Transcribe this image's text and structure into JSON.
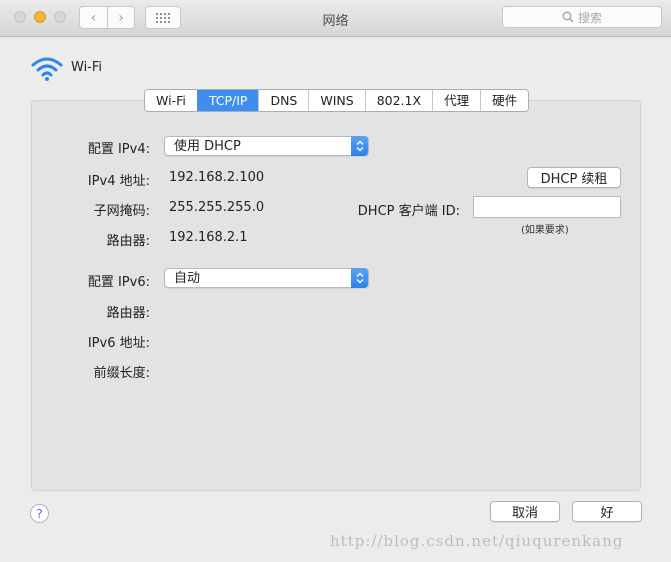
{
  "window": {
    "title": "网络",
    "search_placeholder": "搜索"
  },
  "interface": {
    "name": "Wi-Fi"
  },
  "tabs": [
    {
      "label": "Wi-Fi",
      "active": false
    },
    {
      "label": "TCP/IP",
      "active": true
    },
    {
      "label": "DNS",
      "active": false
    },
    {
      "label": "WINS",
      "active": false
    },
    {
      "label": "802.1X",
      "active": false
    },
    {
      "label": "代理",
      "active": false
    },
    {
      "label": "硬件",
      "active": false
    }
  ],
  "ipv4": {
    "config_label": "配置 IPv4:",
    "config_value": "使用 DHCP",
    "address_label": "IPv4 地址:",
    "address_value": "192.168.2.100",
    "subnet_label": "子网掩码:",
    "subnet_value": "255.255.255.0",
    "router_label": "路由器:",
    "router_value": "192.168.2.1"
  },
  "dhcp": {
    "renew_label": "DHCP 续租",
    "client_id_label": "DHCP 客户端 ID:",
    "client_id_value": "",
    "client_id_hint": "(如果要求)"
  },
  "ipv6": {
    "config_label": "配置 IPv6:",
    "config_value": "自动",
    "router_label": "路由器:",
    "address_label": "IPv6 地址:",
    "prefix_label": "前缀长度:"
  },
  "footer": {
    "help_label": "?",
    "cancel_label": "取消",
    "ok_label": "好"
  },
  "watermark": "http://blog.csdn.net/qiuqurenkang",
  "colors": {
    "accent": "#3d8ef0",
    "minimize": "#f5b53a"
  }
}
